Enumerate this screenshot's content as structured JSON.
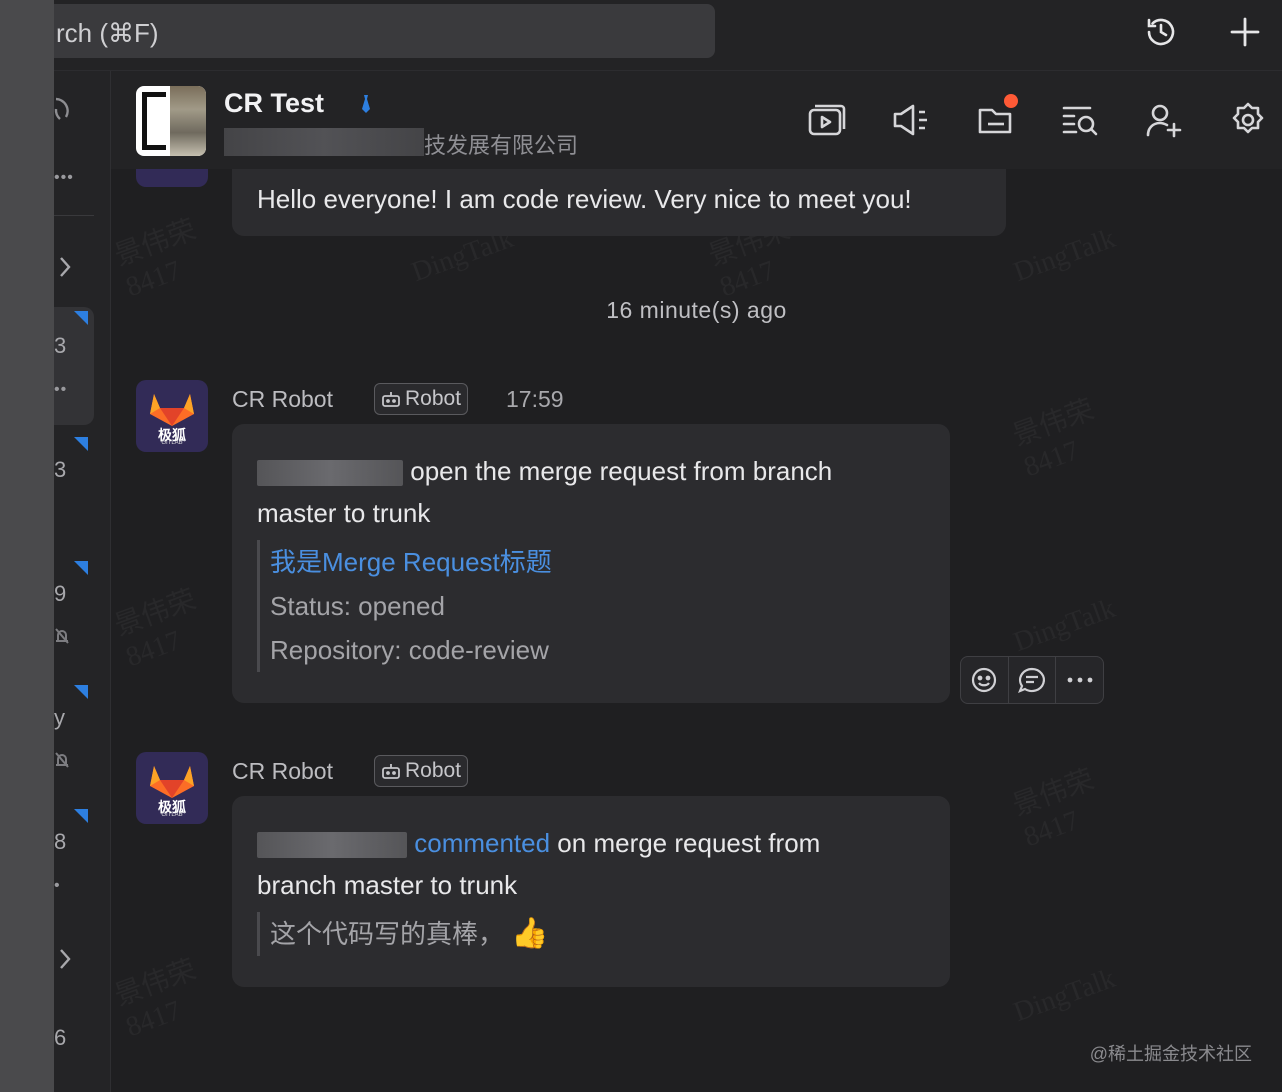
{
  "search": {
    "placeholder_text": "rch (⌘F)"
  },
  "top_actions": {
    "history_icon": "history-icon",
    "add_icon": "plus-icon"
  },
  "sidebar": {
    "items": [
      {
        "text": "3"
      },
      {
        "text": "3"
      },
      {
        "text": "9"
      },
      {
        "text": "y"
      },
      {
        "text": "8"
      },
      {
        "text": "6"
      }
    ]
  },
  "chat": {
    "title": "CR Test",
    "subtitle_visible": "技发展有限公司",
    "header_icons": [
      "video-meeting-icon",
      "announcement-icon",
      "files-icon",
      "search-history-icon",
      "add-member-icon",
      "settings-icon"
    ],
    "files_badge_color": "#ff5a36"
  },
  "messages": [
    {
      "text": "Hello everyone! I am code review. Very nice to meet you!"
    },
    {
      "separator": "16 minute(s) ago"
    },
    {
      "sender": "CR Robot",
      "tag": "Robot",
      "time": "17:59",
      "line1": "open the merge request from branch",
      "line2": "master to trunk",
      "quote_title": "我是Merge Request标题",
      "quote_status": "Status: opened",
      "quote_repo": "Repository: code-review"
    },
    {
      "sender": "CR Robot",
      "tag": "Robot",
      "link": "commented",
      "line1_rest": " on merge request from",
      "line2": "branch master to trunk",
      "quote": "这个代码写的真棒，",
      "emoji": "👍"
    }
  ],
  "bot_avatar": {
    "label": "极狐",
    "sub": "GITLAB"
  },
  "watermarks": {
    "name": "景伟荣",
    "id": "8417",
    "brand": "DingTalk"
  },
  "footer": "@稀土掘金技术社区",
  "colors": {
    "accent_link": "#4a8fe0",
    "sidebar_flag": "#2d7fe0"
  }
}
